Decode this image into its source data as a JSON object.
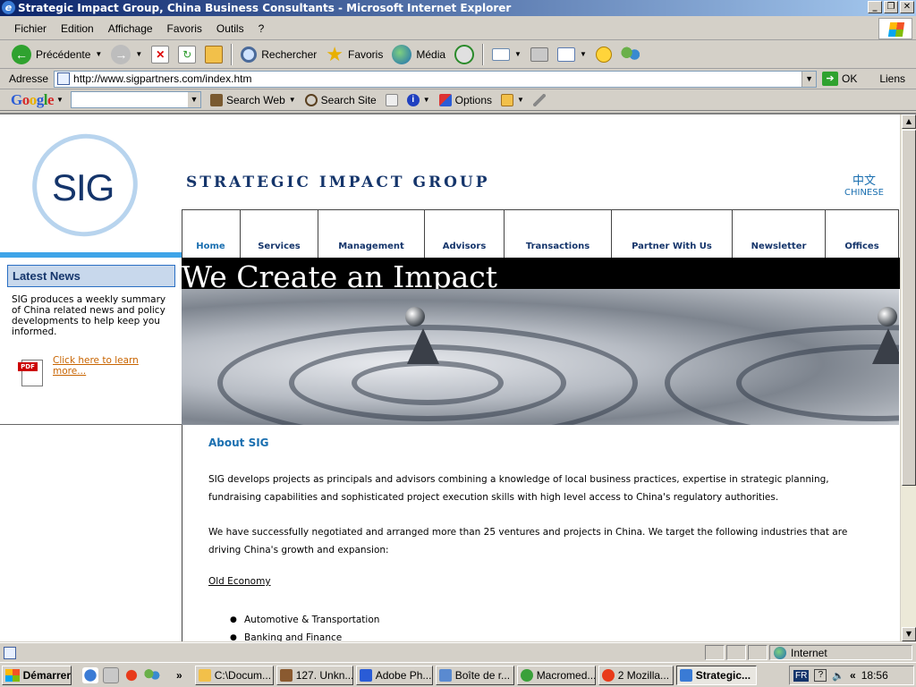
{
  "window": {
    "title": "Strategic Impact Group, China Business Consultants - Microsoft Internet Explorer",
    "min": "_",
    "max": "❐",
    "close": "✕"
  },
  "menu": [
    "Fichier",
    "Edition",
    "Affichage",
    "Favoris",
    "Outils",
    "?"
  ],
  "toolbar": {
    "back": "Précédente",
    "search": "Rechercher",
    "favorites": "Favoris",
    "media": "Média"
  },
  "address": {
    "label": "Adresse",
    "url": "http://www.sigpartners.com/index.htm",
    "go": "OK",
    "links": "Liens"
  },
  "googlebar": {
    "logo": "Google",
    "search_web": "Search Web",
    "search_site": "Search Site",
    "options": "Options"
  },
  "page": {
    "logo": "SIG",
    "company_title": "STRATEGIC IMPACT GROUP",
    "chinese_zh": "中文",
    "chinese_en": "CHINESE",
    "nav": [
      "Home",
      "Services",
      "Management",
      "Advisors",
      "Transactions",
      "Partner With Us",
      "Newsletter",
      "Offices"
    ],
    "banner": "We Create an Impact",
    "latest_news": {
      "title": "Latest News",
      "text": "SIG produces a weekly summary of China related news and policy developments to help keep you informed.",
      "pdf_label": "PDF",
      "link": "Click here to learn more..."
    },
    "about": {
      "title": "About SIG",
      "p1": "SIG develops projects as principals and advisors combining a knowledge of local business practices, expertise in strategic planning, fundraising capabilities and sophisticated project execution skills with high level access to China's regulatory authorities.",
      "p2": "We have successfully negotiated and arranged more than 25 ventures and projects in China. We target the following industries that are driving China's growth and expansion:",
      "old_economy": "Old Economy",
      "industries": [
        "Automotive & Transportation",
        "Banking and Finance"
      ]
    }
  },
  "status": {
    "zone": "Internet"
  },
  "taskbar": {
    "start": "Démarrer",
    "tasks": [
      "C:\\Docum...",
      "127. Unkn...",
      "Adobe Ph...",
      "Boîte de r...",
      "Macromed...",
      "2 Mozilla...",
      "Strategic..."
    ],
    "lang": "FR",
    "time": "18:56"
  },
  "colors": {
    "brand_navy": "#15356b",
    "accent_blue": "#1a6fb0",
    "link_orange": "#c86400"
  }
}
